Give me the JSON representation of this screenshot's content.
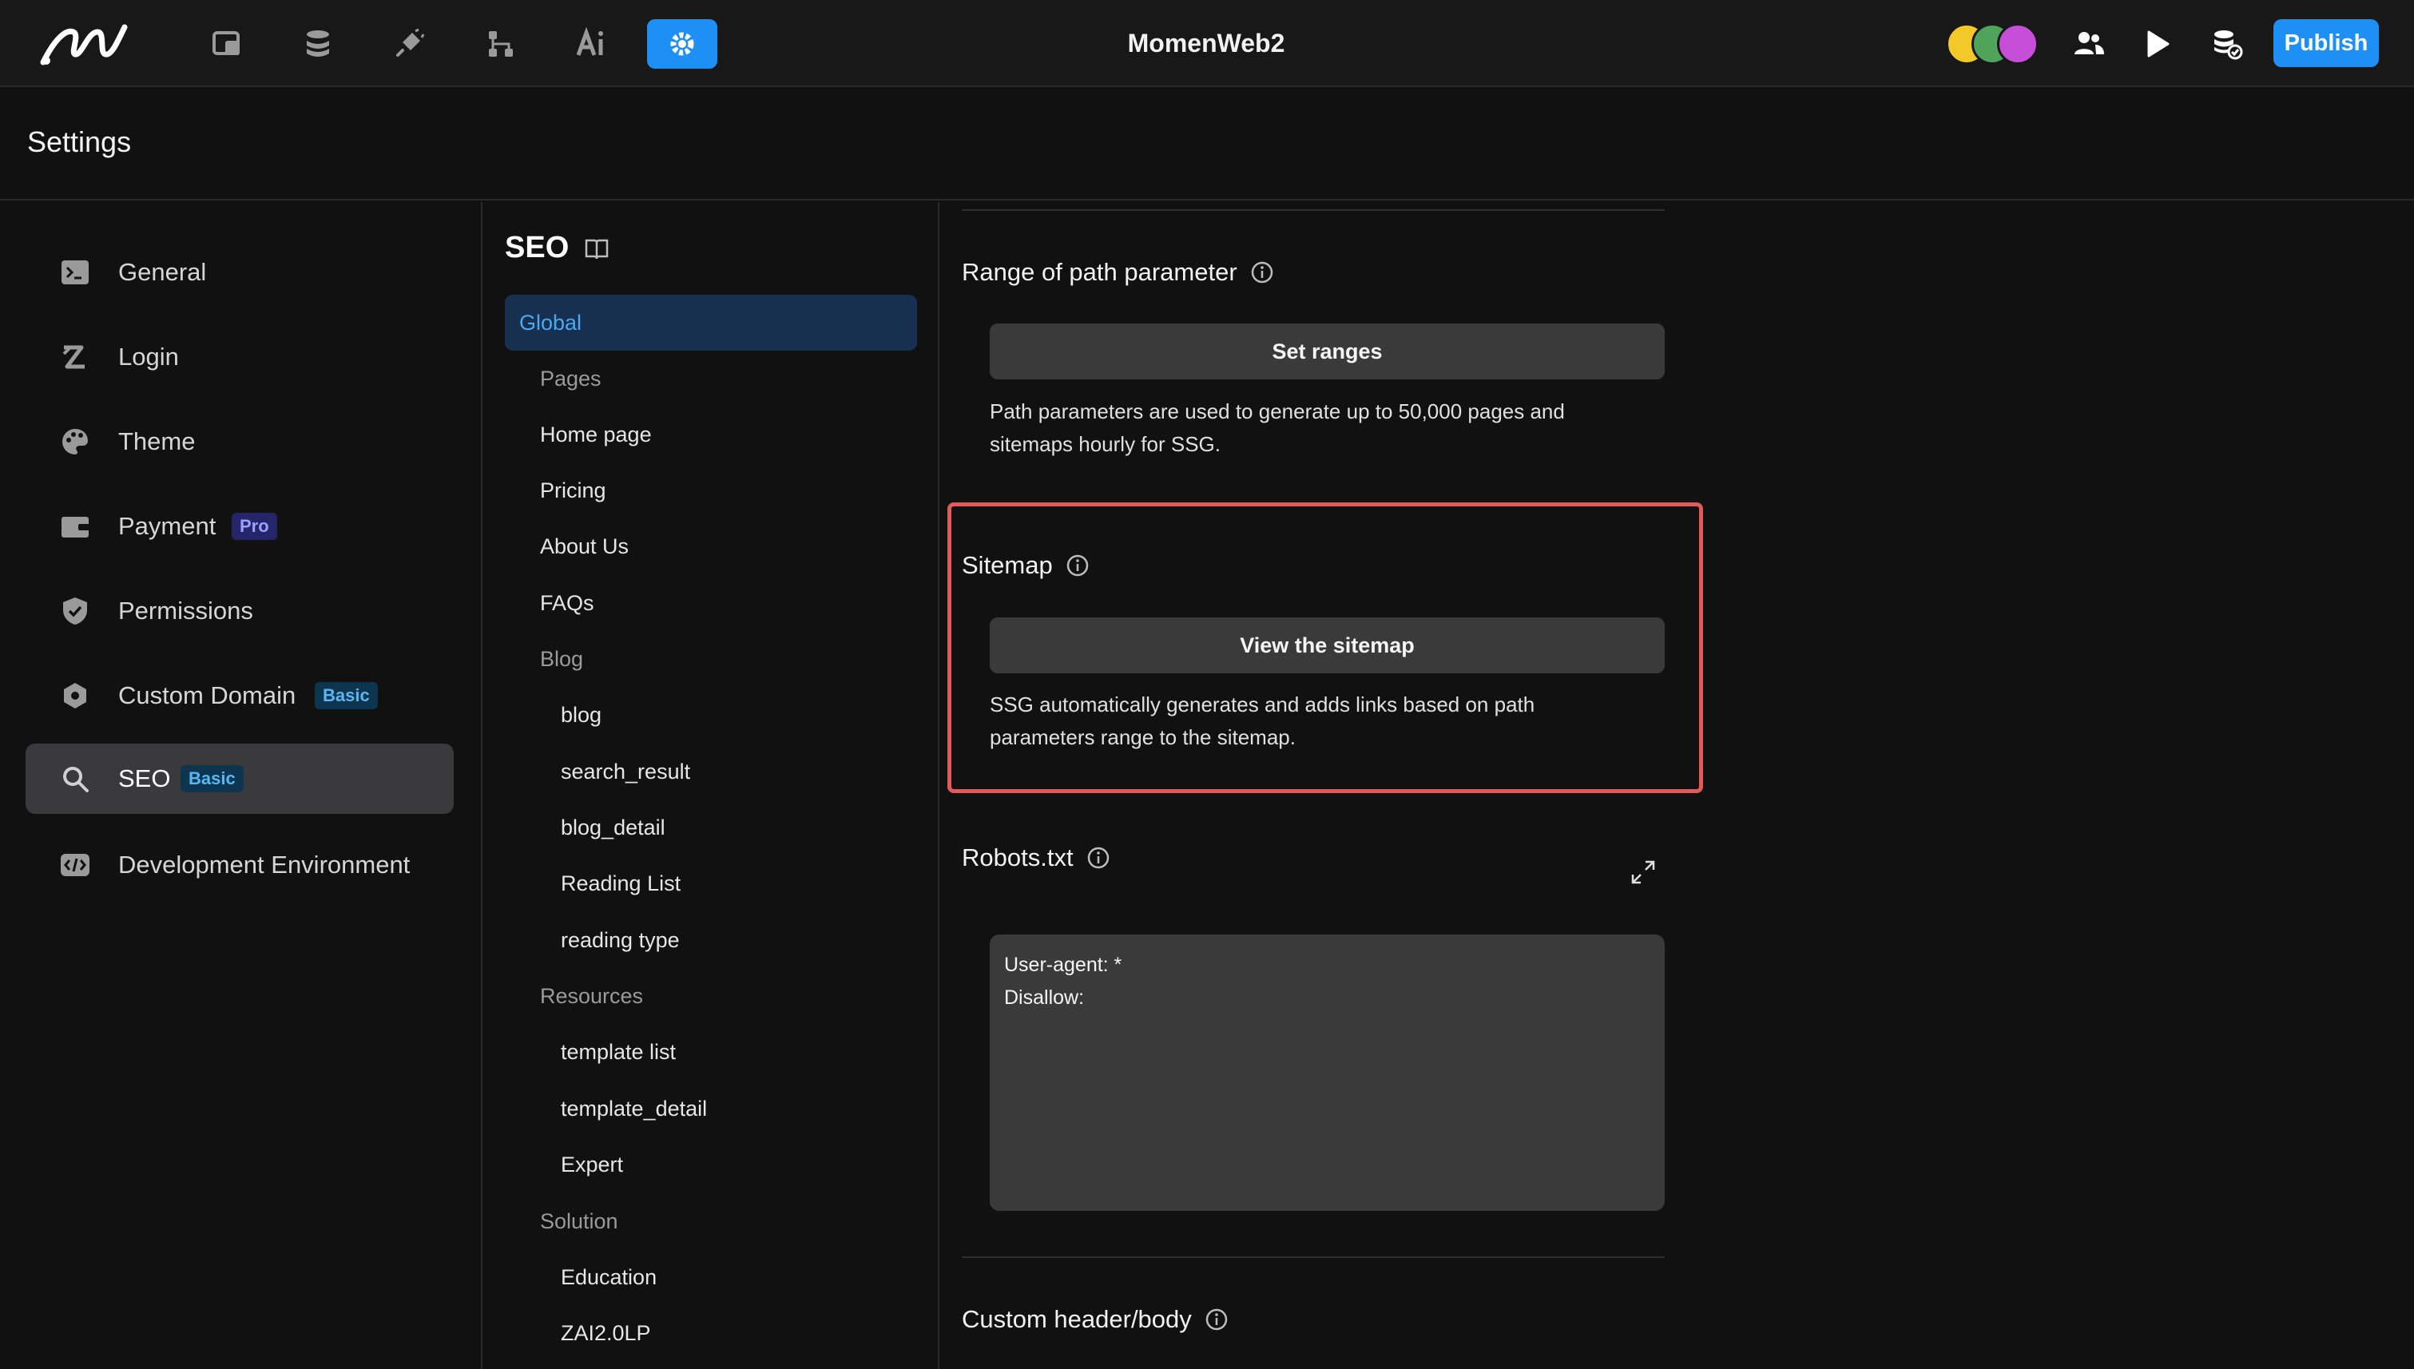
{
  "topbar": {
    "title": "MomenWeb2",
    "publish_label": "Publish",
    "left_icons": [
      "pages-icon",
      "database-icon",
      "plugin-icon",
      "workflow-icon",
      "ai-icon",
      "settings-icon"
    ],
    "right_icons": [
      "users-icon",
      "play-icon",
      "database-check-icon"
    ],
    "accent": "#1e90f5"
  },
  "header": {
    "title": "Settings"
  },
  "leftnav": {
    "items": [
      {
        "label": "General",
        "icon": "terminal-icon"
      },
      {
        "label": "Login",
        "icon": "login-icon"
      },
      {
        "label": "Theme",
        "icon": "palette-icon"
      },
      {
        "label": "Payment",
        "icon": "wallet-icon",
        "badge": "Pro"
      },
      {
        "label": "Permissions",
        "icon": "shield-icon"
      },
      {
        "label": "Custom Domain",
        "icon": "domain-icon",
        "badge": "Basic"
      },
      {
        "label": "SEO",
        "icon": "search-icon",
        "badge": "Basic",
        "active": true
      },
      {
        "label": "Development Environment",
        "icon": "code-icon"
      }
    ]
  },
  "seo_nav": {
    "title": "SEO",
    "global": "Global",
    "groups": {
      "pages": "Pages",
      "blog": "Blog",
      "resources": "Resources",
      "solution": "Solution"
    },
    "pages": [
      "Home page",
      "Pricing",
      "About Us",
      "FAQs"
    ],
    "blog": [
      "blog",
      "search_result",
      "blog_detail",
      "Reading List",
      "reading type"
    ],
    "resources": [
      "template list",
      "template_detail",
      "Expert"
    ],
    "solution": [
      "Education",
      "ZAI2.0LP"
    ]
  },
  "content": {
    "range": {
      "title": "Range of path parameter",
      "button": "Set ranges",
      "help": "Path parameters are used to generate up to 50,000 pages and sitemaps hourly for SSG."
    },
    "sitemap": {
      "title": "Sitemap",
      "button": "View the sitemap",
      "help": "SSG automatically generates and adds links based on path parameters range to the sitemap."
    },
    "robots": {
      "title": "Robots.txt",
      "value": "User-agent: *\nDisallow:"
    },
    "custom": {
      "title": "Custom header/body"
    }
  }
}
